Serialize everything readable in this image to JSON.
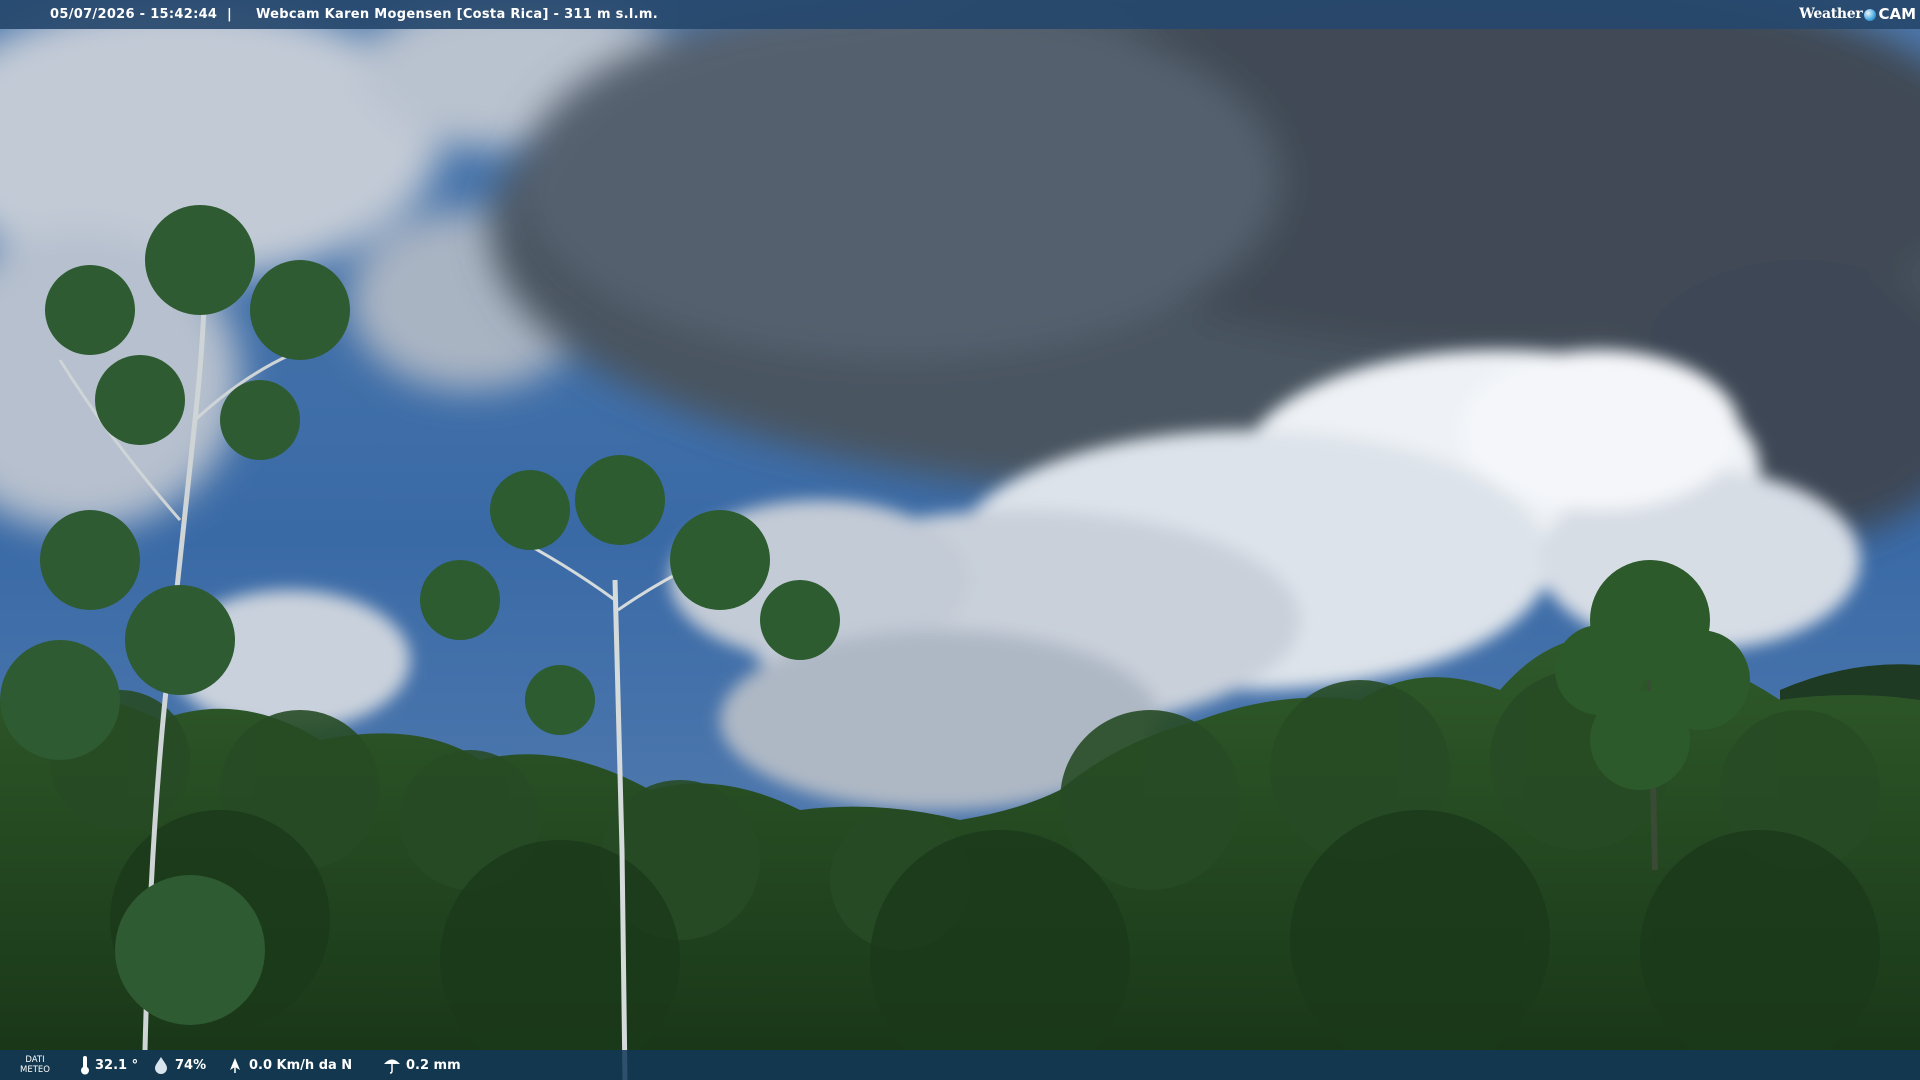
{
  "header": {
    "datetime": "05/07/2026 - 15:42:44",
    "separator": "|",
    "title": "Webcam Karen Mogensen [Costa Rica] - 311 m s.l.m."
  },
  "logo": {
    "word1": "Weather",
    "word2": "CAM"
  },
  "footer": {
    "label_line1": "DATI",
    "label_line2": "METEO",
    "temperature": "32.1 °",
    "humidity": "74%",
    "wind": "0.0 Km/h da N",
    "rain": "0.2 mm"
  },
  "colors": {
    "bar_top": "#26486c",
    "bar_bottom": "#123758",
    "sky_blue": "#3a6fb0",
    "cloud_dark": "#4e5866",
    "foliage": "#1f3f1c"
  },
  "icons": [
    "thermometer-icon",
    "humidity-drop-icon",
    "wind-icon",
    "rain-icon",
    "globe-icon"
  ]
}
